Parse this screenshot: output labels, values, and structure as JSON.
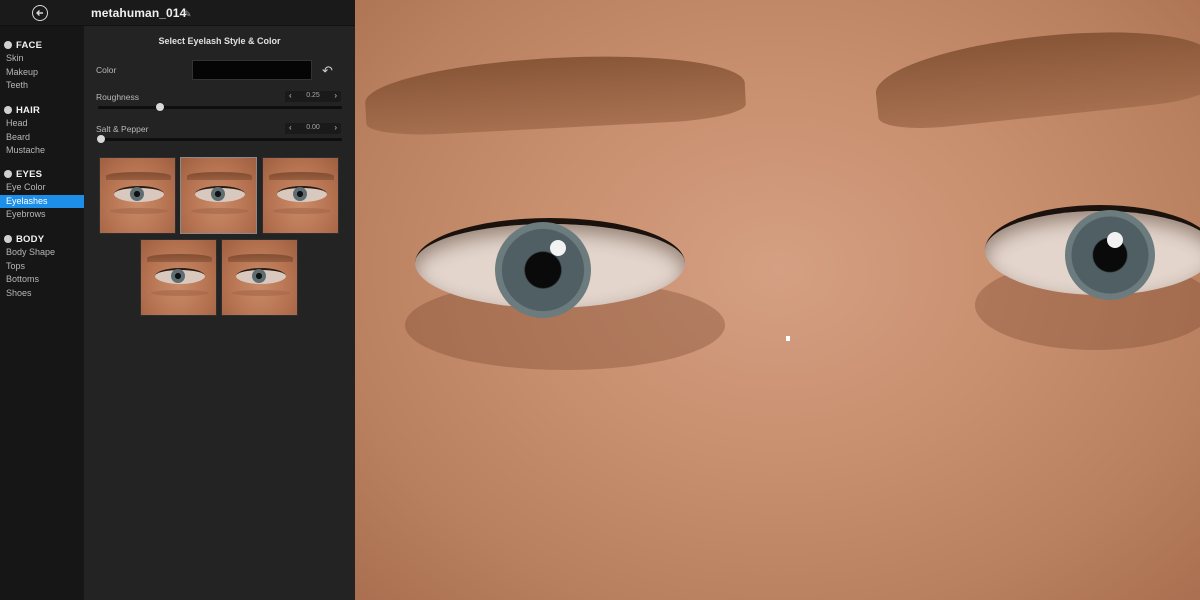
{
  "topbar": {
    "title": "metahuman_014",
    "back_icon": "circle-arrow-left-icon",
    "edit_icon": "pencil-icon"
  },
  "sidebar": {
    "categories": [
      {
        "label": "FACE",
        "icon": "face-icon",
        "items": [
          "Skin",
          "Makeup",
          "Teeth"
        ]
      },
      {
        "label": "HAIR",
        "icon": "hair-icon",
        "items": [
          "Head",
          "Beard",
          "Mustache"
        ]
      },
      {
        "label": "EYES",
        "icon": "eye-icon",
        "items": [
          "Eye Color",
          "Eyelashes",
          "Eyebrows"
        ]
      },
      {
        "label": "BODY",
        "icon": "body-icon",
        "items": [
          "Body Shape",
          "Tops",
          "Bottoms",
          "Shoes"
        ]
      }
    ],
    "active_item": "Eyelashes"
  },
  "panel": {
    "title": "Select Eyelash Style & Color",
    "color_label": "Color",
    "color_value": "#050505",
    "undo_icon": "undo-icon",
    "roughness": {
      "label": "Roughness",
      "value": "0.25"
    },
    "salt_pepper": {
      "label": "Salt & Pepper",
      "value": "0.00"
    },
    "stepper_left": "‹",
    "stepper_right": "›",
    "thumbnails_count": 5,
    "selected_thumbnail": 2
  },
  "viewport": {
    "content": "3D face close-up"
  },
  "colors": {
    "accent": "#1e8fe8",
    "panel_bg": "#232324",
    "sidebar_bg": "#161617"
  }
}
